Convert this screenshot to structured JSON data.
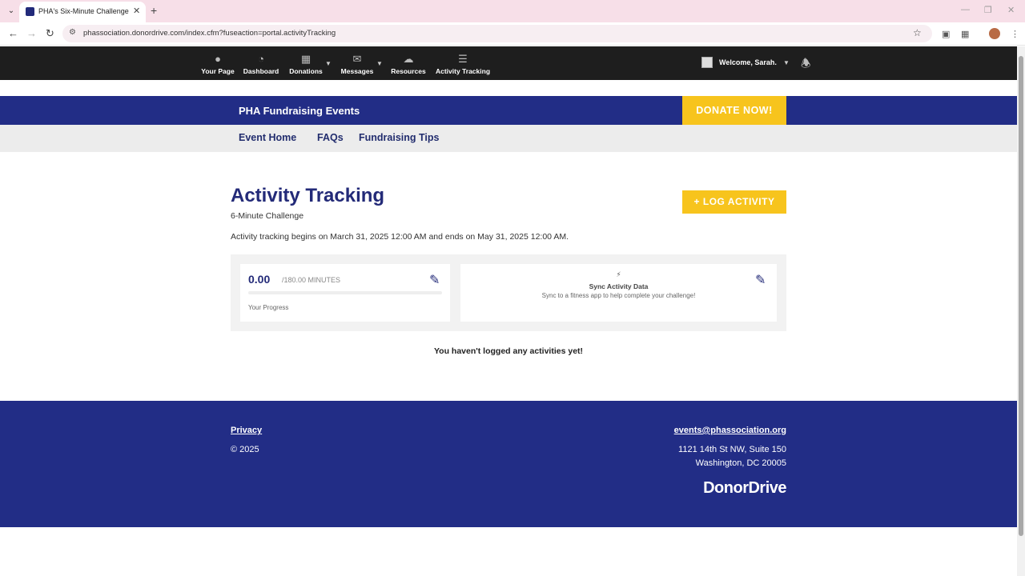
{
  "browser": {
    "tab_title": "PHA's Six-Minute Challenge",
    "url": "phassociation.donordrive.com/index.cfm?fuseaction=portal.activityTracking"
  },
  "topnav": {
    "items": [
      {
        "label": "Your Page",
        "icon": "user-icon"
      },
      {
        "label": "Dashboard",
        "icon": "dashboard-icon"
      },
      {
        "label": "Donations",
        "icon": "gift-icon"
      },
      {
        "label": "Messages",
        "icon": "envelope-icon"
      },
      {
        "label": "Resources",
        "icon": "cloud-download-icon"
      },
      {
        "label": "Activity Tracking",
        "icon": "list-icon"
      }
    ],
    "welcome": "Welcome, Sarah."
  },
  "event": {
    "title": "PHA Fundraising Events",
    "donate_label": "DONATE NOW!",
    "subnav": [
      "Event Home",
      "FAQs",
      "Fundraising Tips"
    ]
  },
  "main": {
    "title": "Activity Tracking",
    "subtitle": "6-Minute Challenge",
    "log_label": "+ LOG ACTIVITY",
    "tracking_note": "Activity tracking begins on March 31, 2025 12:00 AM and ends on May 31, 2025 12:00 AM.",
    "progress": {
      "value": "0.00",
      "goal": "/180.00 MINUTES",
      "fraction": 0,
      "label": "Your Progress"
    },
    "sync": {
      "title": "Sync Activity Data",
      "description": "Sync to a fitness app to help complete your challenge!"
    },
    "empty_message": "You haven't logged any activities yet!"
  },
  "footer": {
    "privacy": "Privacy",
    "copyright": "© 2025",
    "email": "events@phassociation.org",
    "address_line1": "1121 14th St NW, Suite 150",
    "address_line2": "Washington, DC 20005",
    "logo": "DonorDrive"
  },
  "colors": {
    "brand_navy": "#222d86",
    "accent_yellow": "#f7c41d"
  }
}
